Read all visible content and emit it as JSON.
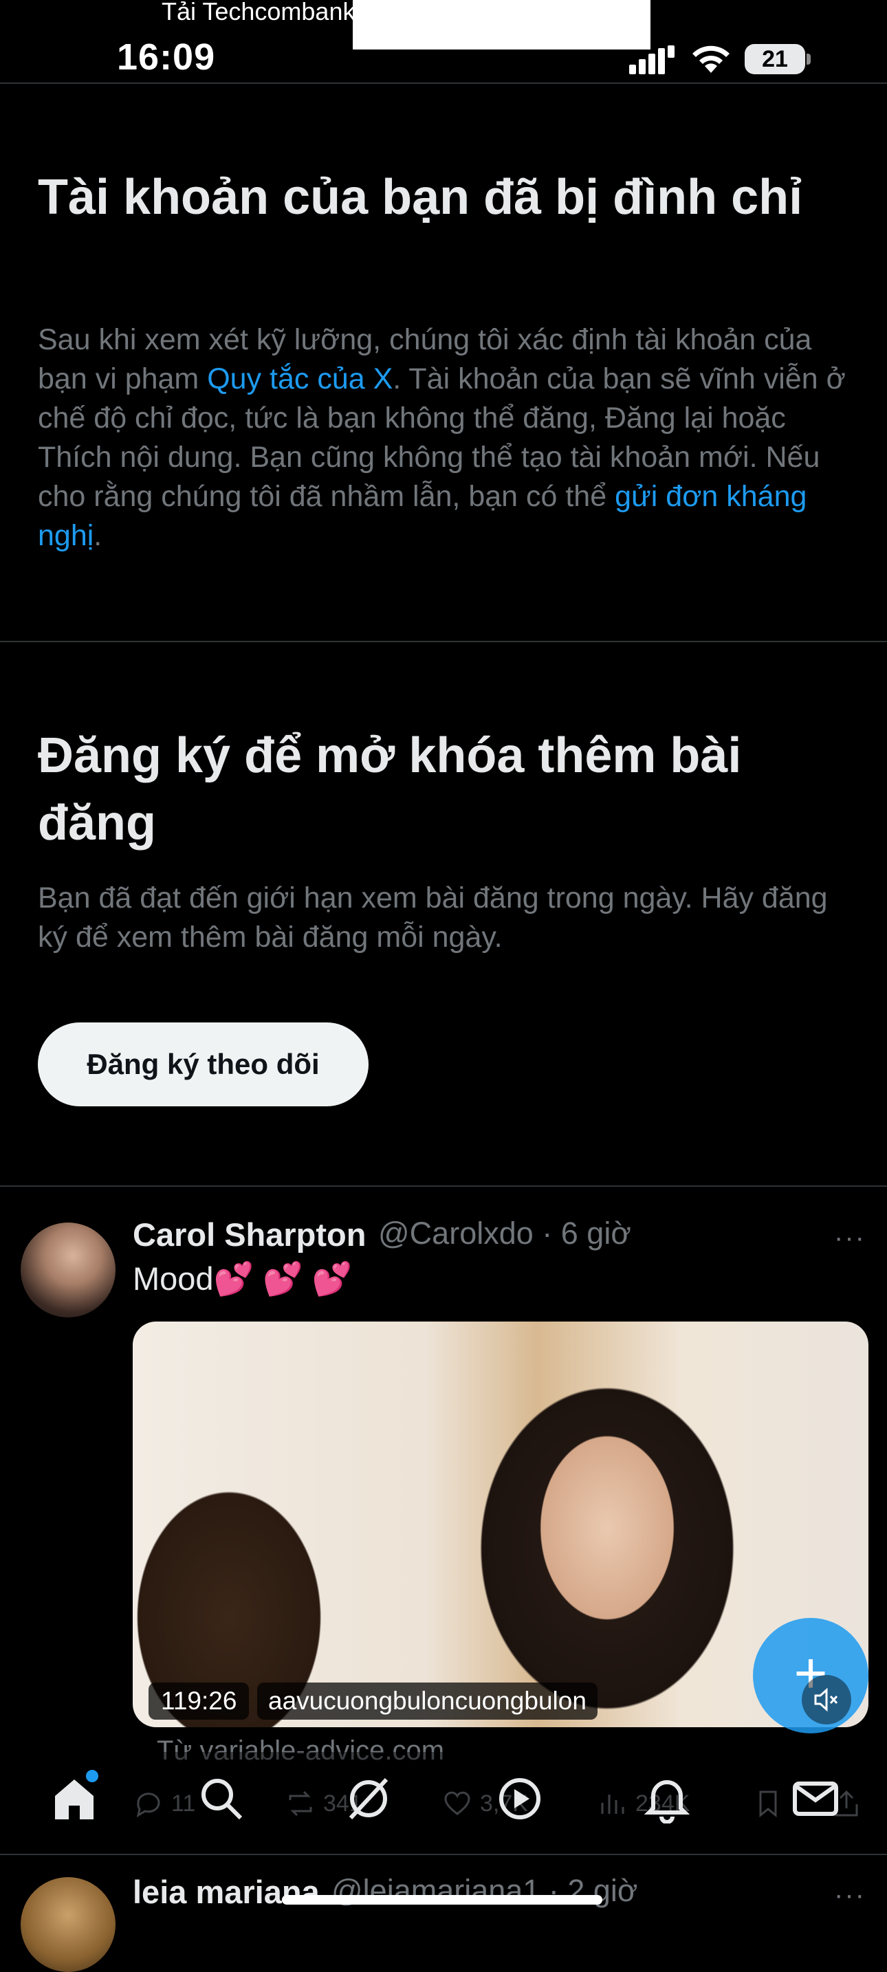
{
  "status_bar": {
    "notification_text": "Tải Techcombank",
    "time": "16:09",
    "battery": "21"
  },
  "suspended": {
    "title": "Tài khoản của bạn đã bị đình chỉ",
    "body_part1": "Sau khi xem xét kỹ lưỡng, chúng tôi xác định tài khoản của bạn vi phạm ",
    "rules_link": "Quy tắc của X",
    "body_part2": ". Tài khoản của bạn sẽ vĩnh viễn ở chế độ chỉ đọc, tức là bạn không thể đăng, Đăng lại hoặc Thích nội dung. Bạn cũng không thể tạo tài khoản mới. Nếu cho rằng chúng tôi đã nhầm lẫn, bạn có thể ",
    "appeal_link": "gửi đơn kháng nghị",
    "body_part3": "."
  },
  "subscribe": {
    "title": "Đăng ký để mở khóa thêm bài đăng",
    "body": "Bạn đã đạt đến giới hạn xem bài đăng trong ngày. Hãy đăng ký để xem thêm bài đăng mỗi ngày.",
    "button_label": "Đăng ký theo dõi"
  },
  "tweet": {
    "name": "Carol Sharpton",
    "handle_time": "@Carolxdo · 6 giờ",
    "more": "···",
    "text": "Mood",
    "emoji": "💕 💕 💕",
    "video_duration": "119:26",
    "video_caption": "aavucuongbuloncuongbulon",
    "source": "Từ variable-advice.com",
    "replies": "11",
    "reposts": "341",
    "likes": "3,7K",
    "views": "234K"
  },
  "next_tweet": {
    "name": "leia mariana",
    "handle_time": "@leiamariana1 · 2 giờ",
    "more": "···"
  },
  "icons": {
    "fab": "plus-icon",
    "mute": "mute-icon"
  },
  "colors": {
    "link": "#1d9bf0",
    "muted": "#71767b",
    "text": "#e7e9ea"
  }
}
